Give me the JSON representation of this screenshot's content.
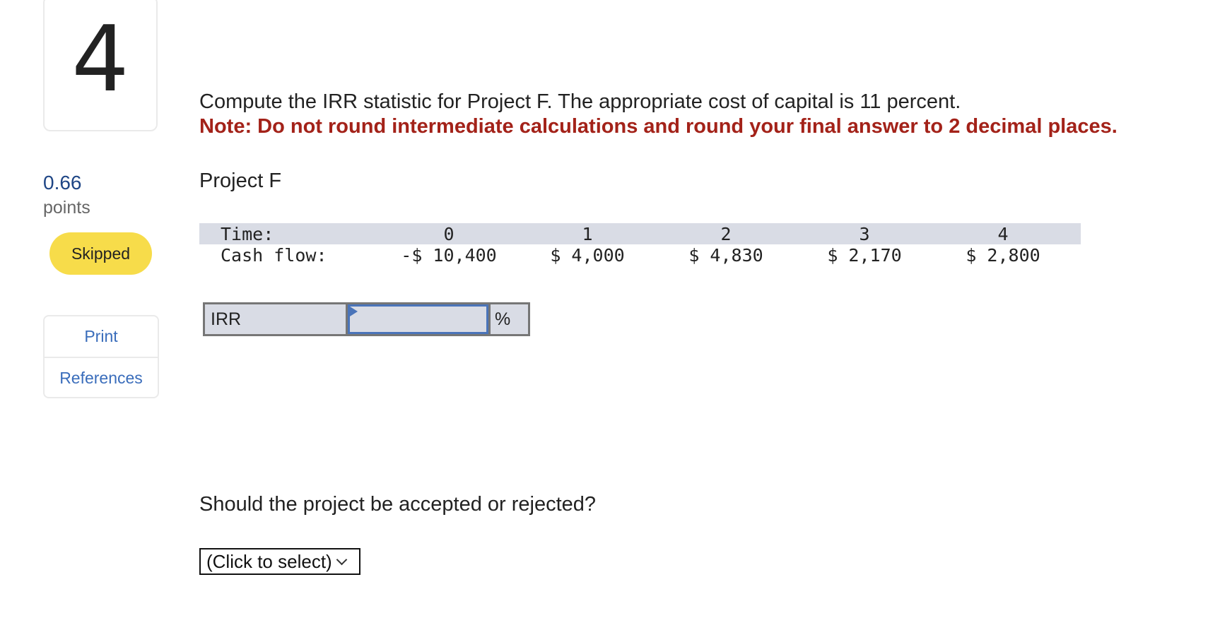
{
  "question": {
    "number": "4",
    "points_value": "0.66",
    "points_label": "points",
    "status": "Skipped",
    "status_color": "#f7dc4a"
  },
  "sidebar_links": [
    {
      "label": "Print"
    },
    {
      "label": "References"
    }
  ],
  "prompt": {
    "text": "Compute the IRR statistic for Project F. The appropriate cost of capital is 11 percent.",
    "note": "Note: Do not round intermediate calculations and round your final answer to 2 decimal places.",
    "note_color": "#a32219"
  },
  "project": {
    "title": "Project F",
    "time_label": "Time:",
    "cash_flow_label": "Cash flow:",
    "periods": [
      "0",
      "1",
      "2",
      "3",
      "4"
    ],
    "cash_flows": [
      "-$ 10,400",
      "$ 4,000",
      "$ 4,830",
      "$ 2,170",
      "$ 2,800"
    ]
  },
  "irr_answer": {
    "label": "IRR",
    "value": "",
    "unit": "%"
  },
  "decision": {
    "question": "Should the project be accepted or rejected?",
    "selected": "(Click to select)"
  }
}
